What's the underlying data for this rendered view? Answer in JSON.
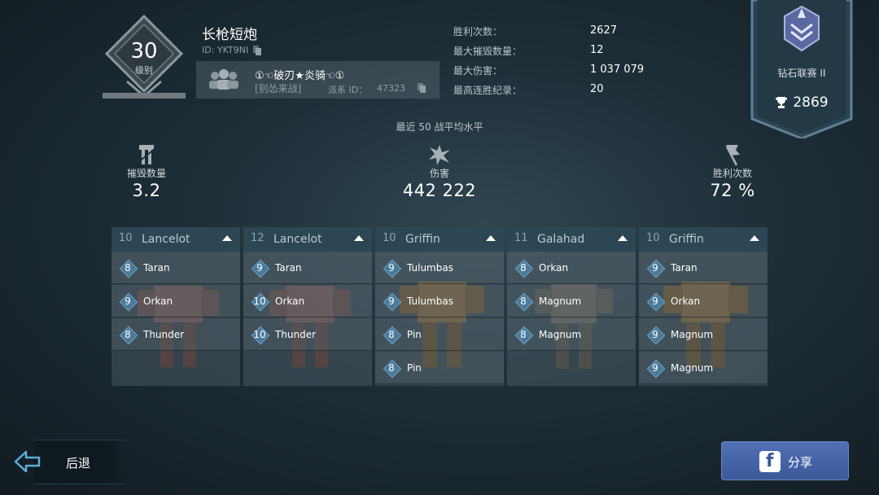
{
  "player": {
    "level": "30",
    "level_label": "级别",
    "name": "长枪短炮",
    "id": "ID: YKT9NI"
  },
  "clan": {
    "name": "①☜破刃★炎骑☜①",
    "tag": "[别怂来战]",
    "id_label": "派系 ID：",
    "id": "47323"
  },
  "stats": [
    {
      "label": "胜利次数：",
      "value": "2627"
    },
    {
      "label": "最大摧毁数量：",
      "value": "12"
    },
    {
      "label": "最大伤害：",
      "value": "1 037 079"
    },
    {
      "label": "最高连胜纪录：",
      "value": "20"
    }
  ],
  "league": {
    "name": "钻石联赛 II",
    "trophies": "2869"
  },
  "averages": {
    "title": "最近 50 战平均水平",
    "kills": {
      "label": "摧毁数量",
      "value": "3.2"
    },
    "damage": {
      "label": "伤害",
      "value": "442 222"
    },
    "wins": {
      "label": "胜利次数",
      "value": "72 %"
    }
  },
  "robots": [
    {
      "level": "10",
      "name": "Lancelot",
      "weapons": [
        {
          "level": "8",
          "name": "Taran"
        },
        {
          "level": "9",
          "name": "Orkan"
        },
        {
          "level": "8",
          "name": "Thunder"
        }
      ]
    },
    {
      "level": "12",
      "name": "Lancelot",
      "weapons": [
        {
          "level": "9",
          "name": "Taran"
        },
        {
          "level": "10",
          "name": "Orkan"
        },
        {
          "level": "10",
          "name": "Thunder"
        }
      ]
    },
    {
      "level": "10",
      "name": "Griffin",
      "weapons": [
        {
          "level": "9",
          "name": "Tulumbas"
        },
        {
          "level": "9",
          "name": "Tulumbas"
        },
        {
          "level": "8",
          "name": "Pin"
        },
        {
          "level": "8",
          "name": "Pin"
        }
      ]
    },
    {
      "level": "11",
      "name": "Galahad",
      "weapons": [
        {
          "level": "8",
          "name": "Orkan"
        },
        {
          "level": "8",
          "name": "Magnum"
        },
        {
          "level": "8",
          "name": "Magnum"
        }
      ]
    },
    {
      "level": "10",
      "name": "Griffin",
      "weapons": [
        {
          "level": "9",
          "name": "Taran"
        },
        {
          "level": "9",
          "name": "Orkan"
        },
        {
          "level": "9",
          "name": "Magnum"
        },
        {
          "level": "9",
          "name": "Magnum"
        }
      ]
    }
  ],
  "nav": {
    "back_label": "后退",
    "share_label": "分享"
  },
  "colors": {
    "background": "#1d2d36",
    "card_header": "#2c4654",
    "facebook": "#3b5998"
  },
  "icons": [
    "copy-icon",
    "clan-members-icon",
    "league-emblem-icon",
    "trophy-icon",
    "kills-icon",
    "damage-icon",
    "wins-flag-icon",
    "collapse-arrow-icon",
    "back-arrow-icon",
    "facebook-icon"
  ]
}
